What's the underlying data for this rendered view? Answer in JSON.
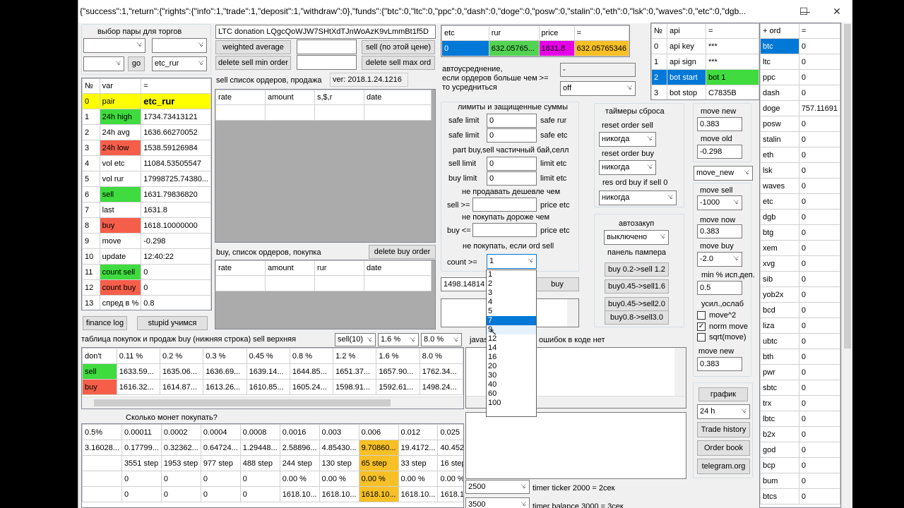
{
  "window": {
    "title": "{\"success\":1,\"return\":{\"rights\":{\"info\":1,\"trade\":1,\"deposit\":1,\"withdraw\":0},\"funds\":{\"btc\":0,\"ltc\":0,\"ppc\":0,\"dash\":0,\"doge\":0,\"posw\":0,\"stalin\":0,\"eth\":0,\"lsk\":0,\"waves\":0,\"etc\":0,\"dgb...",
    "minimize": "—",
    "maximize": "☐",
    "close": "✕"
  },
  "pair_select": {
    "label": "выбор пары для торгов",
    "combo1": "",
    "combo2": "",
    "combo3": "",
    "go": "go",
    "pair": "etc_rur"
  },
  "vars": {
    "headers": [
      "№",
      "var",
      "="
    ],
    "rows": [
      [
        "0",
        "pair",
        "etc_rur",
        "y",
        "y"
      ],
      [
        "1",
        "24h high",
        "1734.73413121",
        "g",
        ""
      ],
      [
        "2",
        "24h avg",
        "1636.66270052",
        "",
        ""
      ],
      [
        "3",
        "24h low",
        "1538.59126984",
        "r",
        ""
      ],
      [
        "4",
        "vol etc",
        "11084.53505547",
        "",
        ""
      ],
      [
        "5",
        "vol rur",
        "17998725.74380...",
        "",
        ""
      ],
      [
        "6",
        "sell",
        "1631.79836820",
        "g",
        ""
      ],
      [
        "7",
        "last",
        "1631.8",
        "",
        ""
      ],
      [
        "8",
        "buy",
        "1618.10000000",
        "r",
        ""
      ],
      [
        "9",
        "move",
        "-0.298",
        "",
        ""
      ],
      [
        "10",
        "update",
        "12:40:22",
        "",
        ""
      ],
      [
        "11",
        "count sell",
        "0",
        "g",
        ""
      ],
      [
        "12",
        "count buy",
        "0",
        "r",
        ""
      ],
      [
        "13",
        "спред в %",
        "0.8",
        "",
        ""
      ]
    ]
  },
  "buttons": {
    "finance_log": "finance log",
    "stupid": "stupid учимся",
    "weighted": "weighted average",
    "sell_price": "sell (по этой цене)",
    "del_sell_min": "delete sell min order",
    "del_sell_max": "delete sell max ord",
    "del_buy": "delete buy order",
    "buy": "buy"
  },
  "donation": {
    "text": "LTC donation  LQgcQoWJW7SHtXdTJnWoAzK9vLmmBt1f5D"
  },
  "sell_orders": {
    "label": "sell список ордеров, продажа",
    "version": "ver: 2018.1.24.1216",
    "headers": [
      "rate",
      "amount",
      "s,$,r",
      "date"
    ]
  },
  "buy_orders": {
    "label": "buy, список ордеров, покупка",
    "headers": [
      "rate",
      "amount",
      "rur",
      "date"
    ]
  },
  "balance": {
    "headers": [
      "etc",
      "rur",
      "price",
      "="
    ],
    "values": [
      "0",
      "632.05765...",
      "1631.8",
      "632.05765346"
    ]
  },
  "averaging": {
    "label1": "автоусреднение,",
    "label2": "если ордеров больше чем >=",
    "label3": "то усредниться",
    "value": "-",
    "mode": "off"
  },
  "limits": {
    "title": "лимиты и защищенные суммы",
    "safe_limit": "safe limit",
    "safe_rur": "safe rur",
    "safe_etc": "safe etc",
    "v1": "0",
    "v2": "0",
    "partial": "part buy,sell частичный бай,селл",
    "sell_limit": "sell limit",
    "buy_limit": "buy limit",
    "limit_etc": "limit etc",
    "v3": "0",
    "v4": "0",
    "no_sell_cheaper": "не продавать дешевле чем",
    "sell_ge": "sell >=",
    "price_etc": "price etc",
    "no_buy_dearer": "не покупать дороже чем",
    "buy_le": "buy <=",
    "no_buy_if": "не покупать, если ord sell",
    "count_ge": "count >=",
    "count_val": "1",
    "price_field": "1498.14814"
  },
  "count_options": [
    "1",
    "2",
    "3",
    "4",
    "5",
    "7",
    "9",
    "12",
    "14",
    "16",
    "20",
    "30",
    "40",
    "60",
    "100"
  ],
  "timers": {
    "title": "таймеры сброса",
    "reset_sell": "reset order sell",
    "reset_buy": "reset order buy",
    "res_ord": "res ord buy if sell 0",
    "never": "никогда"
  },
  "autobuy": {
    "title": "автозакуп",
    "value": "выключено",
    "pumper": "панель пампера",
    "b1": "buy 0.2->sell 1.2",
    "b2": "buy0.45->sell1.6",
    "b3": "buy0.45->sell2.0",
    "b4": "buy0.8->sell3.0"
  },
  "move": {
    "move_new": "move new",
    "mv_new_val": "0.383",
    "move_old": "move old",
    "mv_old_val": "-0.298",
    "move_combo": "move_new",
    "move_sell": "move sell",
    "ms_val": "-1000",
    "move_now": "move now",
    "mn_val": "0.383",
    "move_buy": "move buy",
    "mb_val": "-2.0",
    "min_pct": "min % исп.деп.",
    "min_val": "0.5",
    "usil": "усил.,ослаб",
    "move2": "move^2",
    "norm": "norm move",
    "sqrt": "sqrt(move)",
    "move_new2": "move new",
    "mn2_val": "0.383"
  },
  "api": {
    "headers": [
      "№",
      "api",
      "="
    ],
    "rows": [
      [
        "0",
        "api key",
        "***"
      ],
      [
        "1",
        "api sign",
        "***"
      ],
      [
        "2",
        "bot start",
        "bot 1"
      ],
      [
        "3",
        "bot stop",
        "C7835B"
      ]
    ]
  },
  "funds": {
    "headers": [
      "+ ord",
      "="
    ],
    "rows": [
      [
        "btc",
        "0"
      ],
      [
        "ltc",
        "0"
      ],
      [
        "ppc",
        "0"
      ],
      [
        "dash",
        "0"
      ],
      [
        "doge",
        "757.11691"
      ],
      [
        "posw",
        "0"
      ],
      [
        "stalin",
        "0"
      ],
      [
        "eth",
        "0"
      ],
      [
        "lsk",
        "0"
      ],
      [
        "waves",
        "0"
      ],
      [
        "etc",
        "0"
      ],
      [
        "dgb",
        "0"
      ],
      [
        "btg",
        "0"
      ],
      [
        "xem",
        "0"
      ],
      [
        "xvg",
        "0"
      ],
      [
        "sib",
        "0"
      ],
      [
        "yob2x",
        "0"
      ],
      [
        "bcd",
        "0"
      ],
      [
        "liza",
        "0"
      ],
      [
        "ubtc",
        "0"
      ],
      [
        "bth",
        "0"
      ],
      [
        "pwr",
        "0"
      ],
      [
        "sbtc",
        "0"
      ],
      [
        "trx",
        "0"
      ],
      [
        "lbtc",
        "0"
      ],
      [
        "b2x",
        "0"
      ],
      [
        "god",
        "0"
      ],
      [
        "bcp",
        "0"
      ],
      [
        "bum",
        "0"
      ],
      [
        "btcs",
        "0"
      ]
    ]
  },
  "table_buysell": {
    "label": "таблица покупок и продаж buy (нижняя строка) sell верхняя",
    "c1": "sell(10)",
    "c2": "1.6 %",
    "c3": "8.0 %",
    "headers": [
      "don't",
      "0.11 %",
      "0.2 %",
      "0.3 %",
      "0.45 %",
      "0.8 %",
      "1.2 %",
      "1.6 %",
      "8.0 %"
    ],
    "sell": [
      "sell",
      "1633.59...",
      "1635.06...",
      "1636.69...",
      "1639.14...",
      "1644.85...",
      "1651.37...",
      "1657.90...",
      "1762.34..."
    ],
    "buy": [
      "buy",
      "1616.32...",
      "1614.87...",
      "1613.26...",
      "1610.85...",
      "1605.24...",
      "1598.91...",
      "1592.61...",
      "1498.24..."
    ]
  },
  "coins": {
    "label": "Сколько монет покупать?",
    "headers": [
      "0.5%",
      "0.00011",
      "0.0002",
      "0.0004",
      "0.0008",
      "0.0016",
      "0.003",
      "0.006",
      "0.012",
      "0.025"
    ],
    "r1": [
      "3.16028...",
      "0.17799...",
      "0.32362...",
      "0.64724...",
      "1.29448...",
      "2.58896...",
      "4.85430...",
      "9.70860...",
      "19.4172...",
      "40.452"
    ],
    "r2": [
      "",
      "3551 step",
      "1953 step",
      "977 step",
      "488 step",
      "244 step",
      "130 step",
      "65 step",
      "33 step",
      "16 step"
    ],
    "r3": [
      "",
      "0",
      "0",
      "0",
      "0",
      "0.00 %",
      "0.00 %",
      "0.00 %",
      "0.00 %",
      "0.00 %"
    ],
    "r4": [
      "",
      "0",
      "0",
      "0",
      "0",
      "1618.10...",
      "1618.10...",
      "1618.10...",
      "1618.10...",
      "1618.1"
    ]
  },
  "js": {
    "label": "javas",
    "errors": "ошибок в коде нет"
  },
  "right_btns": {
    "chart": "график",
    "period": "24 h",
    "trade_history": "Trade history",
    "order_book": "Order book",
    "telegram": "telegram.org"
  },
  "timer_ticker": {
    "value": "2500",
    "label": "timer ticker 2000 = 2сек"
  },
  "timer_balance": {
    "value": "3500",
    "label": "timer balance 3000 = 3сек"
  }
}
